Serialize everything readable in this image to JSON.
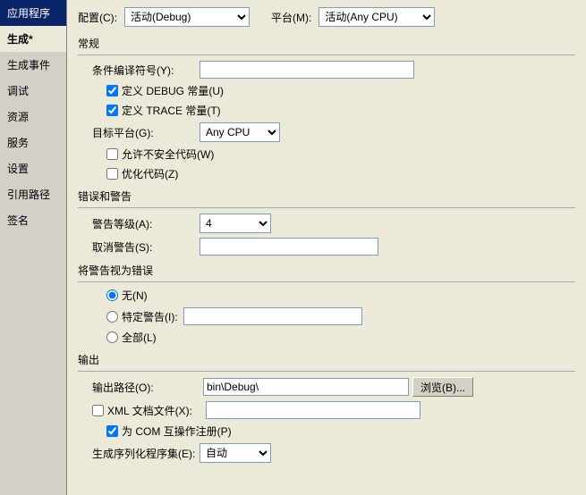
{
  "sidebar": {
    "items": [
      {
        "id": "app",
        "label": "应用程序"
      },
      {
        "id": "build",
        "label": "生成*"
      },
      {
        "id": "build-events",
        "label": "生成事件"
      },
      {
        "id": "debug",
        "label": "调试"
      },
      {
        "id": "resources",
        "label": "资源"
      },
      {
        "id": "services",
        "label": "服务"
      },
      {
        "id": "settings",
        "label": "设置"
      },
      {
        "id": "ref-paths",
        "label": "引用路径"
      },
      {
        "id": "sign",
        "label": "签名"
      }
    ]
  },
  "header": {
    "config_label": "配置(C):",
    "config_value": "活动(Debug)",
    "platform_label": "平台(M):",
    "platform_value": "活动(Any CPU)"
  },
  "general": {
    "section_title": "常规",
    "conditional_label": "条件编译符号(Y):",
    "conditional_value": "",
    "define_debug_label": "定义 DEBUG 常量(U)",
    "define_trace_label": "定义 TRACE 常量(T)",
    "target_platform_label": "目标平台(G):",
    "target_platform_value": "Any CPU",
    "allow_unsafe_label": "允许不安全代码(W)",
    "optimize_label": "优化代码(Z)"
  },
  "errors": {
    "section_title": "错误和警告",
    "warning_level_label": "警告等级(A):",
    "warning_level_value": "4",
    "suppress_warnings_label": "取消警告(S):",
    "suppress_warnings_value": ""
  },
  "treat_warnings": {
    "section_title": "将警告视为错误",
    "none_label": "无(N)",
    "specific_label": "特定警告(I):",
    "specific_value": "",
    "all_label": "全部(L)"
  },
  "output": {
    "section_title": "输出",
    "output_path_label": "输出路径(O):",
    "output_path_value": "bin\\Debug\\",
    "browse_label": "浏览(B)...",
    "xml_docs_label": "XML 文档文件(X):",
    "xml_docs_value": "",
    "com_interop_label": "为 COM 互操作注册(P)",
    "serial_label": "生成序列化程序集(E):",
    "serial_value": "自动"
  }
}
